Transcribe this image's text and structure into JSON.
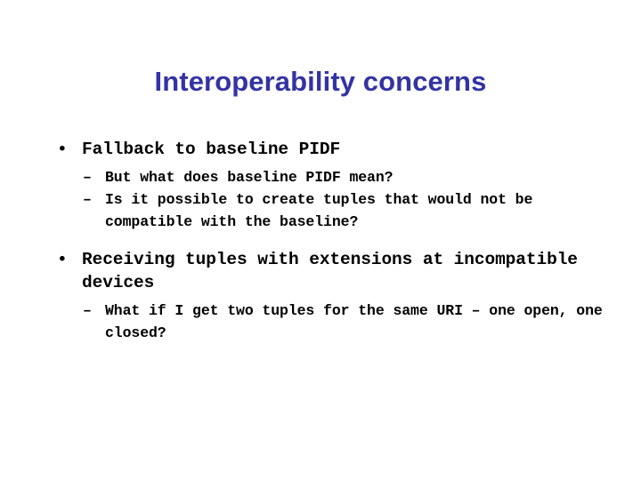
{
  "slide": {
    "title": "Interoperability concerns",
    "title_color": "#3333a5",
    "background_color": "#ffffff",
    "body_color": "#000000",
    "bullet_marker": "•",
    "sub_bullet_marker": "–",
    "groups": [
      {
        "bullet": "Fallback to baseline PIDF",
        "sub_bullets": [
          "But what does baseline PIDF mean?",
          "Is it possible to create tuples that would not be compatible with the baseline?"
        ]
      },
      {
        "bullet": "Receiving tuples with extensions at incompatible devices",
        "sub_bullets": [
          "What if I get two tuples for the same URI – one open, one closed?"
        ]
      }
    ]
  }
}
